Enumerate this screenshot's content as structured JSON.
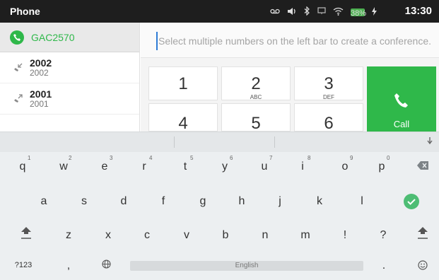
{
  "status_bar": {
    "app_title": "Phone",
    "battery_label": "38%",
    "time": "13:30",
    "icons": [
      "voicemail-icon",
      "volume-icon",
      "bluetooth-icon",
      "screen-icon",
      "wifi-icon",
      "battery-icon",
      "charging-icon"
    ]
  },
  "account": {
    "name": "GAC2570"
  },
  "call_log": [
    {
      "number": "2002",
      "sub": "2002",
      "direction": "missed-incoming"
    },
    {
      "number": "2001",
      "sub": "2001",
      "direction": "outgoing"
    }
  ],
  "dialer": {
    "hint": "Select multiple numbers on the left bar to create a conference.",
    "keys": [
      {
        "digit": "1",
        "letters": ""
      },
      {
        "digit": "2",
        "letters": "ABC"
      },
      {
        "digit": "3",
        "letters": "DEF"
      },
      {
        "digit": "4",
        "letters": ""
      },
      {
        "digit": "5",
        "letters": ""
      },
      {
        "digit": "6",
        "letters": ""
      }
    ],
    "call_label": "Call",
    "accent": "#2fb84a"
  },
  "keyboard": {
    "row1": [
      {
        "letter": "q",
        "hint": "1"
      },
      {
        "letter": "w",
        "hint": "2"
      },
      {
        "letter": "e",
        "hint": "3"
      },
      {
        "letter": "r",
        "hint": "4"
      },
      {
        "letter": "t",
        "hint": "5"
      },
      {
        "letter": "y",
        "hint": "6"
      },
      {
        "letter": "u",
        "hint": "7"
      },
      {
        "letter": "i",
        "hint": "8"
      },
      {
        "letter": "o",
        "hint": "9"
      },
      {
        "letter": "p",
        "hint": "0"
      }
    ],
    "row2": [
      "a",
      "s",
      "d",
      "f",
      "g",
      "h",
      "j",
      "k",
      "l"
    ],
    "row3": [
      "z",
      "x",
      "c",
      "v",
      "b",
      "n",
      "m",
      "!",
      "?"
    ],
    "symbols_key": "?123",
    "comma_key": ",",
    "space_label": "English",
    "period_key": "."
  }
}
